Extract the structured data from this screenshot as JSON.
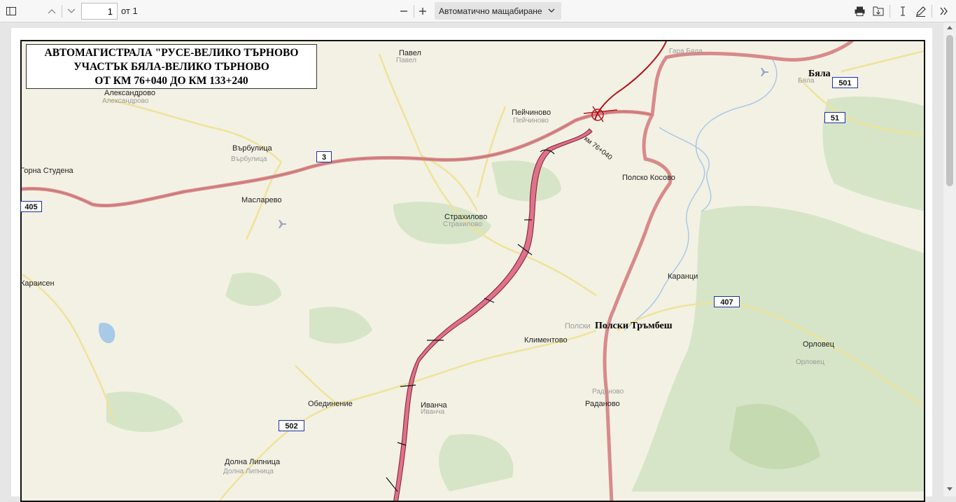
{
  "toolbar": {
    "page_number": "1",
    "page_total": "от 1",
    "zoom_label": "Автоматично мащабиране"
  },
  "map": {
    "title_lines": [
      "АВТОМАГИСТРАЛА \"РУСЕ-ВЕЛИКО ТЪРНОВО",
      "УЧАСТЪК БЯЛА-ВЕЛИКО ТЪРНОВО",
      "ОТ КМ 76+040 ДО КМ 133+240"
    ],
    "route_label": "км 76+040",
    "major_towns": [
      "Бяла",
      "Полски Тръмбеш"
    ],
    "towns": [
      "Павел",
      "Александрово",
      "Пейчиново",
      "Върбулица",
      "Горна Студена",
      "Масларево",
      "Страхилово",
      "Полско Косово",
      "Караисен",
      "Каранци",
      "Климентово",
      "Орловец",
      "Обединение",
      "Иванча",
      "Раданово",
      "Долна Липница",
      "Гара Бяла",
      "Полски"
    ],
    "road_numbers": [
      "3",
      "405",
      "501",
      "51",
      "407",
      "502"
    ],
    "colors": {
      "highway": "#d88a8a",
      "new_route_fill": "#e0708c",
      "secondary_road": "#efe39a",
      "forest": "#d3e3c4",
      "water": "#a9c9e9",
      "shield_border": "#1a2fa6"
    }
  }
}
